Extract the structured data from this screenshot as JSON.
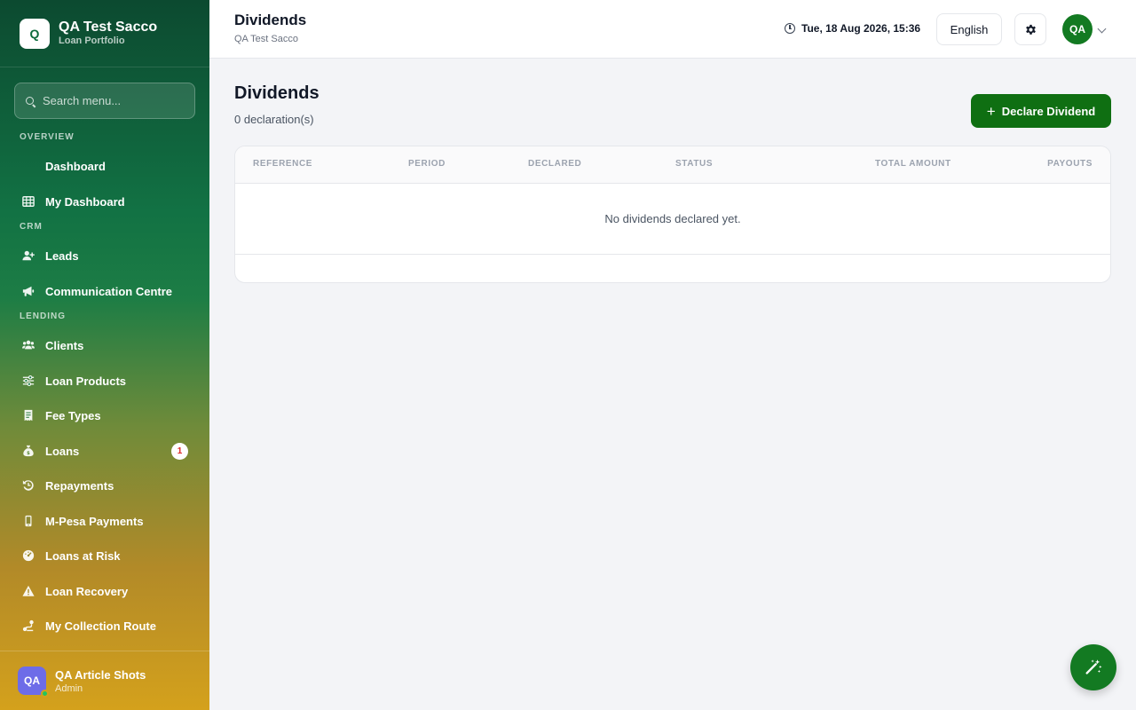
{
  "sidebar": {
    "brand": {
      "logo": "Q",
      "name": "QA Test Sacco",
      "subtitle": "Loan Portfolio"
    },
    "search_placeholder": "Search menu...",
    "sections": {
      "overview": "OVERVIEW",
      "crm": "CRM",
      "lending": "LENDING"
    },
    "items": {
      "dashboard": "Dashboard",
      "my_dashboard": "My Dashboard",
      "leads": "Leads",
      "communication": "Communication Centre",
      "clients": "Clients",
      "loan_products": "Loan Products",
      "fee_types": "Fee Types",
      "loans": "Loans",
      "loans_badge": "1",
      "repayments": "Repayments",
      "mpesa": "M-Pesa Payments",
      "loans_at_risk": "Loans at Risk",
      "loan_recovery": "Loan Recovery",
      "collection_route": "My Collection Route"
    },
    "user": {
      "initials": "QA",
      "name": "QA Article Shots",
      "role": "Admin"
    }
  },
  "topbar": {
    "title": "Dividends",
    "subtitle": "QA Test Sacco",
    "datetime": "Tue, 18 Aug 2026, 15:36",
    "language": "English",
    "avatar_initials": "QA"
  },
  "main": {
    "title": "Dividends",
    "count_text": "0 declaration(s)",
    "declare_button": "Declare Dividend",
    "table": {
      "columns": [
        "REFERENCE",
        "PERIOD",
        "DECLARED",
        "STATUS",
        "TOTAL AMOUNT",
        "PAYOUTS"
      ],
      "empty_message": "No dividends declared yet."
    }
  },
  "colors": {
    "primary": "#0f6f12",
    "sidebar_top": "#0c4a30",
    "sidebar_bottom": "#d4a11c",
    "badge_text": "#dc2626"
  }
}
